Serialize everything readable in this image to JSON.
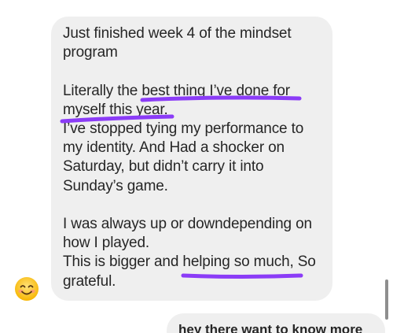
{
  "conversation": {
    "incoming_message": {
      "text": "Just finished week 4 of the mindset\nprogram\n\nLiterally the best thing I’ve done for\nmyself this year.\nI’ve stopped tying my performance to\nmy identity. And Had a shocker on\nSaturday, but didn’t carry it into\nSunday’s game.\n\nI was always up or downdepending on\nhow I played.\nThis is bigger and helping so much, So\ngrateful.",
      "highlighted_phrases": [
        "best thing I’ve done for myself this year.",
        "helping so much,"
      ],
      "highlight_color": "#8b3cf7"
    },
    "sender_avatar": {
      "icon": "smiling-face-emoji-icon"
    },
    "outgoing_message": {
      "text": "hey there   want to know more"
    }
  },
  "colors": {
    "incoming_bubble": "#efefef",
    "outgoing_bubble": "#efefef",
    "text": "#262626",
    "scrollbar": "#8e8e8e"
  }
}
